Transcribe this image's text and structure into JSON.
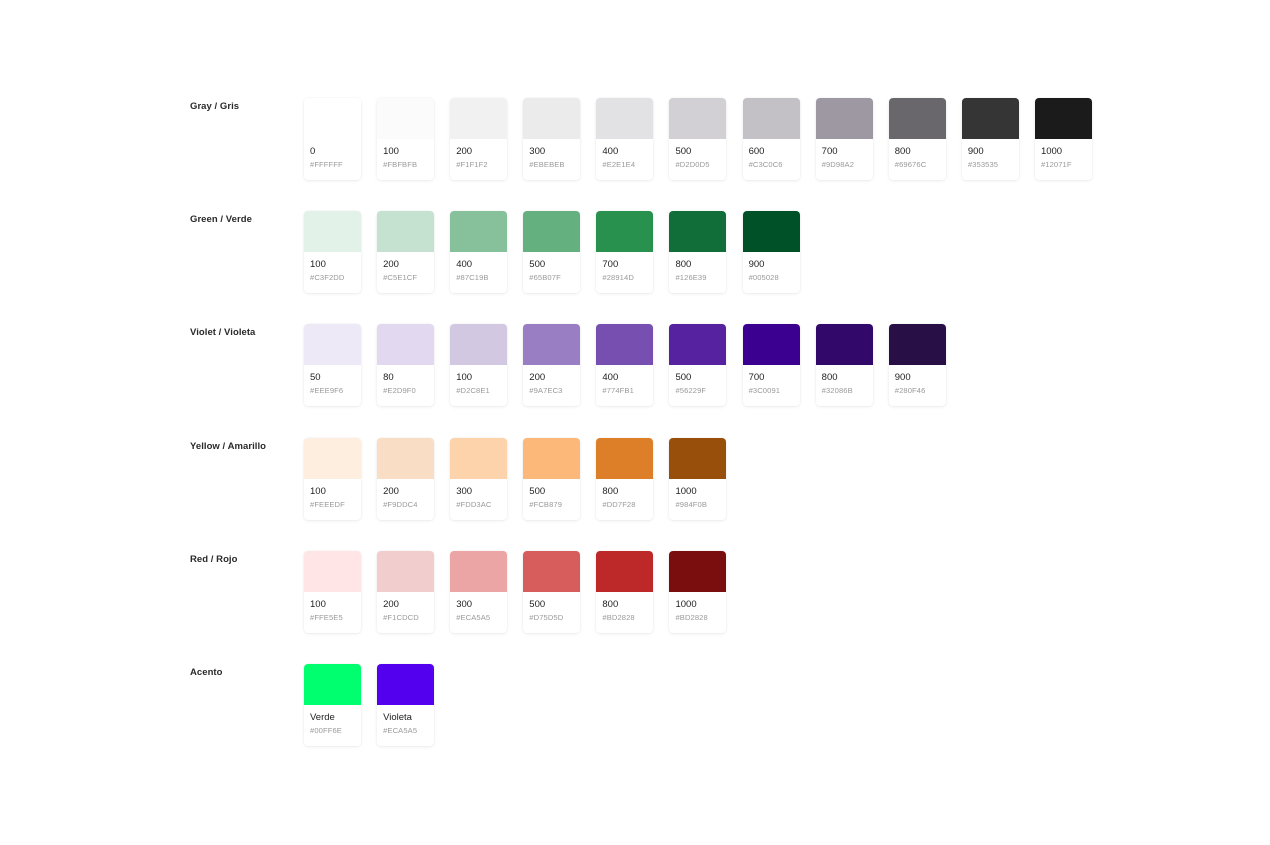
{
  "groups": [
    {
      "label": "Gray / Gris",
      "swatches": [
        {
          "step": "0",
          "hex": "#FFFFFF",
          "color": "#FFFFFF"
        },
        {
          "step": "100",
          "hex": "#FBFBFB",
          "color": "#FBFBFB"
        },
        {
          "step": "200",
          "hex": "#F1F1F2",
          "color": "#F1F1F2"
        },
        {
          "step": "300",
          "hex": "#EBEBEB",
          "color": "#EBEBEB"
        },
        {
          "step": "400",
          "hex": "#E2E1E4",
          "color": "#E2E1E4"
        },
        {
          "step": "500",
          "hex": "#D2D0D5",
          "color": "#D2D0D5"
        },
        {
          "step": "600",
          "hex": "#C3C0C6",
          "color": "#C3C0C6"
        },
        {
          "step": "700",
          "hex": "#9D98A2",
          "color": "#9D98A2"
        },
        {
          "step": "800",
          "hex": "#69676C",
          "color": "#69676C"
        },
        {
          "step": "900",
          "hex": "#353535",
          "color": "#353535"
        },
        {
          "step": "1000",
          "hex": "#12071F",
          "color": "#1B1B1B"
        }
      ]
    },
    {
      "label": "Green / Verde",
      "swatches": [
        {
          "step": "100",
          "hex": "#C3F2DD",
          "color": "#E2F2E8"
        },
        {
          "step": "200",
          "hex": "#C5E1CF",
          "color": "#C5E1CF"
        },
        {
          "step": "400",
          "hex": "#87C19B",
          "color": "#87C19B"
        },
        {
          "step": "500",
          "hex": "#65B07F",
          "color": "#65B07F"
        },
        {
          "step": "700",
          "hex": "#28914D",
          "color": "#28914D"
        },
        {
          "step": "800",
          "hex": "#126E39",
          "color": "#126E39"
        },
        {
          "step": "900",
          "hex": "#005028",
          "color": "#005028"
        }
      ]
    },
    {
      "label": "Violet / Violeta",
      "swatches": [
        {
          "step": "50",
          "hex": "#EEE9F6",
          "color": "#EEE9F6"
        },
        {
          "step": "80",
          "hex": "#E2D9F0",
          "color": "#E2D9F0"
        },
        {
          "step": "100",
          "hex": "#D2C8E1",
          "color": "#D2C8E1"
        },
        {
          "step": "200",
          "hex": "#9A7EC3",
          "color": "#9A7EC3"
        },
        {
          "step": "400",
          "hex": "#774FB1",
          "color": "#774FB1"
        },
        {
          "step": "500",
          "hex": "#56229F",
          "color": "#56229F"
        },
        {
          "step": "700",
          "hex": "#3C0091",
          "color": "#3C0091"
        },
        {
          "step": "800",
          "hex": "#32086B",
          "color": "#32086B"
        },
        {
          "step": "900",
          "hex": "#280F46",
          "color": "#280F46"
        }
      ]
    },
    {
      "label": "Yellow / Amarillo",
      "swatches": [
        {
          "step": "100",
          "hex": "#FEEEDF",
          "color": "#FEEEDF"
        },
        {
          "step": "200",
          "hex": "#F9DDC4",
          "color": "#F9DDC4"
        },
        {
          "step": "300",
          "hex": "#FDD3AC",
          "color": "#FDD3AC"
        },
        {
          "step": "500",
          "hex": "#FCB879",
          "color": "#FCB879"
        },
        {
          "step": "800",
          "hex": "#DD7F28",
          "color": "#DD7F28"
        },
        {
          "step": "1000",
          "hex": "#984F0B",
          "color": "#984F0B"
        }
      ]
    },
    {
      "label": "Red / Rojo",
      "swatches": [
        {
          "step": "100",
          "hex": "#FFE5E5",
          "color": "#FFE5E5"
        },
        {
          "step": "200",
          "hex": "#F1CDCD",
          "color": "#F1CDCD"
        },
        {
          "step": "300",
          "hex": "#ECA5A5",
          "color": "#ECA5A5"
        },
        {
          "step": "500",
          "hex": "#D75D5D",
          "color": "#D75D5D"
        },
        {
          "step": "800",
          "hex": "#BD2828",
          "color": "#BD2828"
        },
        {
          "step": "1000",
          "hex": "#BD2828",
          "color": "#7A0E0E"
        }
      ]
    },
    {
      "label": "Acento",
      "swatches": [
        {
          "step": "Verde",
          "hex": "#00FF6E",
          "color": "#00FF6E"
        },
        {
          "step": "Violeta",
          "hex": "#ECA5A5",
          "color": "#5200EE"
        }
      ]
    }
  ]
}
